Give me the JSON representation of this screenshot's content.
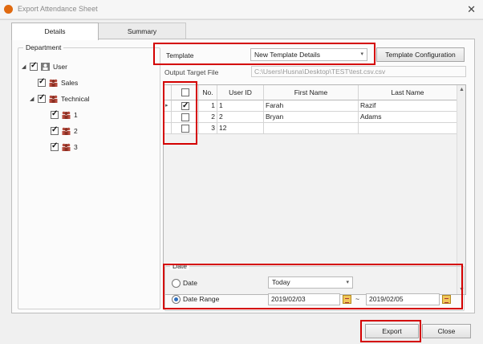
{
  "window": {
    "title": "Export Attendance Sheet",
    "close_glyph": "✕"
  },
  "tabs": [
    {
      "label": "Details",
      "active": true
    },
    {
      "label": "Summary",
      "active": false
    }
  ],
  "department": {
    "legend": "Department",
    "tree": [
      {
        "label": "User",
        "icon": "user-icon",
        "checked": true,
        "level": 0,
        "expander": "◢"
      },
      {
        "label": "Sales",
        "icon": "group-icon",
        "checked": true,
        "level": 1
      },
      {
        "label": "Technical",
        "icon": "group-icon",
        "checked": true,
        "level": 1,
        "expander": "◢"
      },
      {
        "label": "1",
        "icon": "group-icon",
        "checked": true,
        "level": 2
      },
      {
        "label": "2",
        "icon": "group-icon",
        "checked": true,
        "level": 2
      },
      {
        "label": "3",
        "icon": "group-icon",
        "checked": true,
        "level": 2
      }
    ]
  },
  "template": {
    "label": "Template",
    "selected": "New Template Details",
    "arrow": "▾",
    "config_button": "Template Configuration"
  },
  "output": {
    "label": "Output Target File",
    "path": "C:\\Users\\Husna\\Desktop\\TEST\\test.csv.csv"
  },
  "grid": {
    "headers": [
      "",
      "No.",
      "User ID",
      "First Name",
      "Last Name"
    ],
    "rows": [
      {
        "checked": true,
        "current": true,
        "no": "1",
        "user_id": "1",
        "first_name": "Farah",
        "last_name": "Razif"
      },
      {
        "checked": false,
        "current": false,
        "no": "2",
        "user_id": "2",
        "first_name": "Bryan",
        "last_name": "Adams"
      },
      {
        "checked": false,
        "current": false,
        "no": "3",
        "user_id": "12",
        "first_name": "",
        "last_name": ""
      }
    ],
    "row_indicator": "▸",
    "scroll_up": "▲",
    "scroll_down": "▼"
  },
  "date": {
    "legend": "Date",
    "option_date": "Date",
    "option_range": "Date Range",
    "selected_option": "range",
    "date_preset": "Today",
    "arrow": "▾",
    "range_from": "2019/02/03",
    "range_separator": "~",
    "range_to": "2019/02/05"
  },
  "footer": {
    "export_label": "Export",
    "close_label": "Close"
  },
  "colors": {
    "highlight": "#d40000",
    "selection": "#2f6fbd",
    "brand": "#e06a10"
  }
}
